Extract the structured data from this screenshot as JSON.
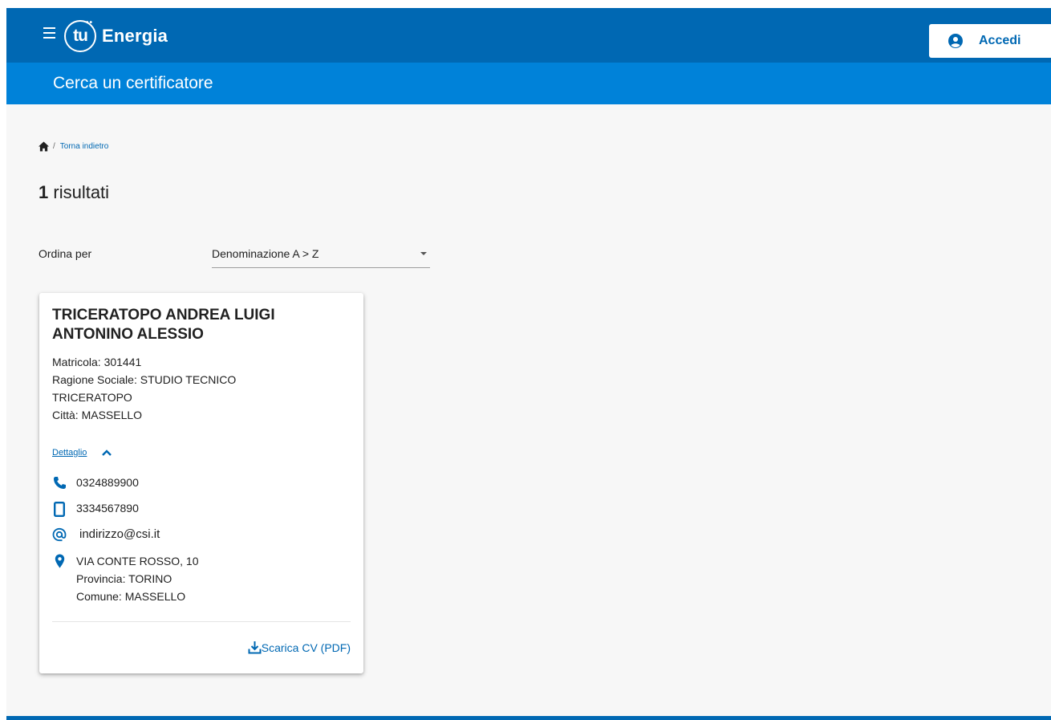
{
  "header": {
    "logo_mark": "tu",
    "logo_text": "Energia",
    "login_label": "Accedi",
    "subtitle": "Cerca un certificatore"
  },
  "breadcrumb": {
    "separator": "/",
    "back_label": "Torna indietro"
  },
  "results": {
    "count": "1",
    "label": "risultati"
  },
  "sort": {
    "label": "Ordina per",
    "selected": "Denominazione A > Z"
  },
  "card": {
    "name_line1": "TRICERATOPO ANDREA LUIGI",
    "name_line2": "ANTONINO ALESSIO",
    "matricola": "Matricola: 301441",
    "ragione_sociale_line1": "Ragione Sociale: STUDIO TECNICO",
    "ragione_sociale_line2": "TRICERATOPO",
    "citta": "Città: MASSELLO",
    "detail_label": "Dettaglio",
    "phone": "0324889900",
    "mobile": "3334567890",
    "email": "indirizzo@csi.it",
    "address": "VIA CONTE ROSSO, 10",
    "provincia": "Provincia: TORINO",
    "comune": "Comune: MASSELLO",
    "download_label": "Scarica CV (PDF)"
  },
  "icons": [
    "menu-icon",
    "user-icon",
    "home-icon",
    "caret-down-icon",
    "chevron-up-icon",
    "phone-icon",
    "mobile-icon",
    "at-icon",
    "location-pin-icon",
    "download-icon"
  ],
  "colors": {
    "primary": "#0068b3",
    "secondary": "#0082d9",
    "background": "#f7f7f7"
  }
}
